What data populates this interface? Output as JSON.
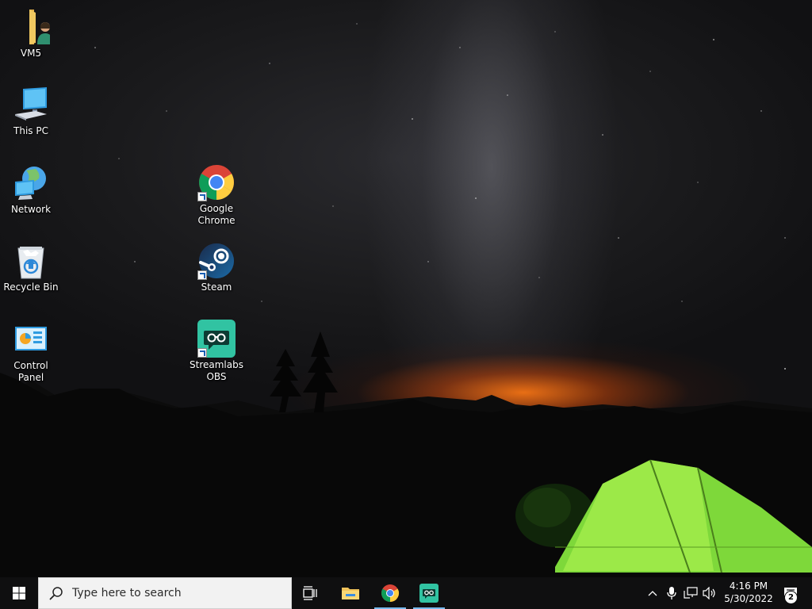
{
  "desktop": {
    "icons": [
      {
        "label": "VM5",
        "icon": "user-folder-icon"
      },
      {
        "label": "This PC",
        "icon": "computer-icon"
      },
      {
        "label": "Network",
        "icon": "network-icon"
      },
      {
        "label": "Recycle Bin",
        "icon": "recycle-bin-icon"
      },
      {
        "label": "Control Panel",
        "icon": "control-panel-icon"
      },
      {
        "label": "Google Chrome",
        "icon": "chrome-icon",
        "shortcut": true
      },
      {
        "label": "Steam",
        "icon": "steam-icon",
        "shortcut": true
      },
      {
        "label": "Streamlabs OBS",
        "icon": "streamlabs-icon",
        "shortcut": true
      }
    ]
  },
  "taskbar": {
    "search_placeholder": "Type here to search",
    "pinned": [
      {
        "name": "Task View",
        "icon": "task-view-icon"
      },
      {
        "name": "File Explorer",
        "icon": "file-explorer-icon"
      },
      {
        "name": "Google Chrome",
        "icon": "chrome-icon",
        "running": true
      },
      {
        "name": "Streamlabs OBS",
        "icon": "streamlabs-icon",
        "running": true
      }
    ],
    "tray": {
      "time": "4:16 PM",
      "date": "5/30/2022",
      "notification_count": "2"
    }
  },
  "colors": {
    "taskbar_bg": "#0f0f10",
    "accent": "#76b9ed",
    "streamlabs": "#31c3a2",
    "tent": "#8fe03a"
  }
}
